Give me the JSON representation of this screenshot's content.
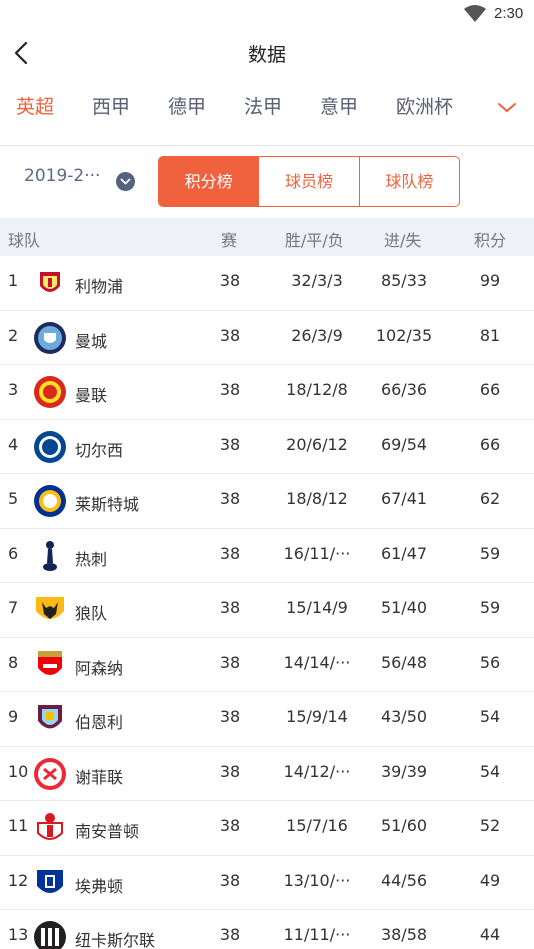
{
  "status_bar": {
    "time": "2:30"
  },
  "nav": {
    "title": "数据"
  },
  "leagues": [
    "英超",
    "西甲",
    "德甲",
    "法甲",
    "意甲",
    "欧洲杯"
  ],
  "season": "2019-2···",
  "segments": [
    "积分榜",
    "球员榜",
    "球队榜"
  ],
  "columns": {
    "team": "球队",
    "played": "赛",
    "wdl": "胜/平/负",
    "goals": "进/失",
    "points": "积分"
  },
  "colors": {
    "accent": "#f0623e",
    "header_bg": "#eef1f8"
  },
  "rows": [
    {
      "rank": "1",
      "team": "利物浦",
      "played": "38",
      "wdl": "32/3/3",
      "goals": "85/33",
      "points": "99",
      "crest": "liverpool-crest-icon"
    },
    {
      "rank": "2",
      "team": "曼城",
      "played": "38",
      "wdl": "26/3/9",
      "goals": "102/35",
      "points": "81",
      "crest": "man-city-crest-icon"
    },
    {
      "rank": "3",
      "team": "曼联",
      "played": "38",
      "wdl": "18/12/8",
      "goals": "66/36",
      "points": "66",
      "crest": "man-united-crest-icon"
    },
    {
      "rank": "4",
      "team": "切尔西",
      "played": "38",
      "wdl": "20/6/12",
      "goals": "69/54",
      "points": "66",
      "crest": "chelsea-crest-icon"
    },
    {
      "rank": "5",
      "team": "莱斯特城",
      "played": "38",
      "wdl": "18/8/12",
      "goals": "67/41",
      "points": "62",
      "crest": "leicester-crest-icon"
    },
    {
      "rank": "6",
      "team": "热刺",
      "played": "38",
      "wdl": "16/11/···",
      "goals": "61/47",
      "points": "59",
      "crest": "tottenham-crest-icon"
    },
    {
      "rank": "7",
      "team": "狼队",
      "played": "38",
      "wdl": "15/14/9",
      "goals": "51/40",
      "points": "59",
      "crest": "wolves-crest-icon"
    },
    {
      "rank": "8",
      "team": "阿森纳",
      "played": "38",
      "wdl": "14/14/···",
      "goals": "56/48",
      "points": "56",
      "crest": "arsenal-crest-icon"
    },
    {
      "rank": "9",
      "team": "伯恩利",
      "played": "38",
      "wdl": "15/9/14",
      "goals": "43/50",
      "points": "54",
      "crest": "burnley-crest-icon"
    },
    {
      "rank": "10",
      "team": "谢菲联",
      "played": "38",
      "wdl": "14/12/···",
      "goals": "39/39",
      "points": "54",
      "crest": "sheffield-united-crest-icon"
    },
    {
      "rank": "11",
      "team": "南安普顿",
      "played": "38",
      "wdl": "15/7/16",
      "goals": "51/60",
      "points": "52",
      "crest": "southampton-crest-icon"
    },
    {
      "rank": "12",
      "team": "埃弗顿",
      "played": "38",
      "wdl": "13/10/···",
      "goals": "44/56",
      "points": "49",
      "crest": "everton-crest-icon"
    },
    {
      "rank": "13",
      "team": "纽卡斯尔联",
      "played": "38",
      "wdl": "11/11/···",
      "goals": "38/58",
      "points": "44",
      "crest": "newcastle-crest-icon"
    }
  ]
}
